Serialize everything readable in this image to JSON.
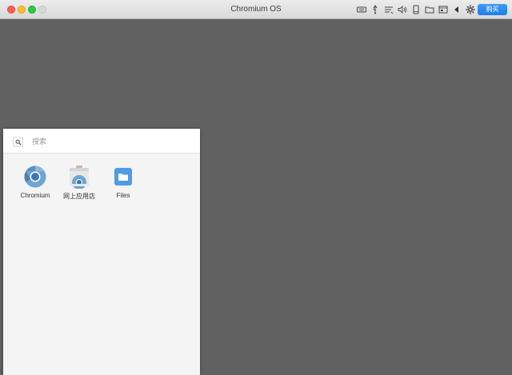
{
  "window": {
    "title": "Chromium OS"
  },
  "toolbar": {
    "icons": [
      "keyboard-icon",
      "usb-icon",
      "network-icon",
      "speaker-icon",
      "device-icon",
      "folder-share-icon",
      "display-icon",
      "back-arrow-icon",
      "gear-icon"
    ],
    "buy_label": "购买",
    "accent": "#1d7fe6"
  },
  "launcher": {
    "search": {
      "placeholder": "搜索"
    },
    "apps": [
      {
        "label": "Chromium",
        "icon": "chromium-icon"
      },
      {
        "label": "网上应用店",
        "icon": "web-store-icon"
      },
      {
        "label": "Files",
        "icon": "files-icon"
      }
    ]
  },
  "colors": {
    "desktop": "#616161",
    "launcher_bg": "#f4f4f4"
  }
}
